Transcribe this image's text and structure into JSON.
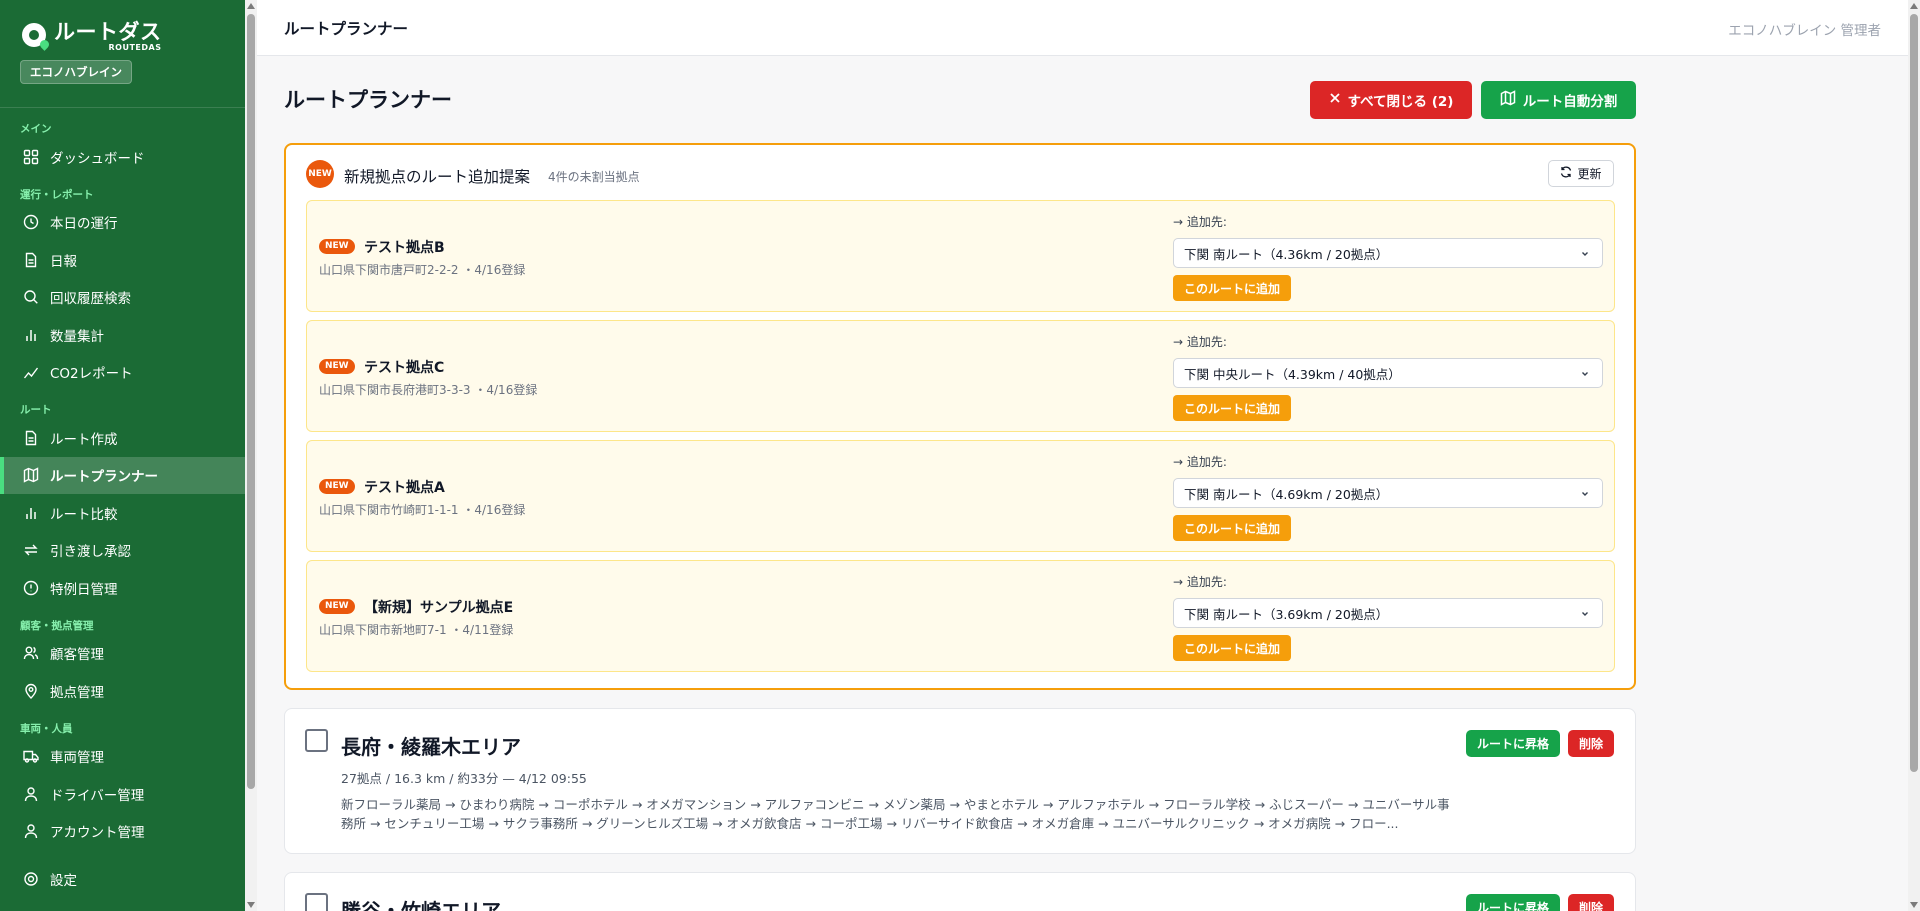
{
  "brand": {
    "name": "ルートダス",
    "sub": "ROUTEDAS",
    "company": "エコノハブレイン"
  },
  "colors": {
    "sidebar": "#1b6b35",
    "primary": "#16a34a",
    "danger": "#dc2626",
    "warning": "#f59e0b",
    "new": "#ea580c"
  },
  "sidebar": {
    "sections": [
      {
        "label": "メイン",
        "items": [
          {
            "label": "ダッシュボード",
            "icon": "grid-icon"
          }
        ]
      },
      {
        "label": "運行・レポート",
        "items": [
          {
            "label": "本日の運行",
            "icon": "clock-icon"
          },
          {
            "label": "日報",
            "icon": "document-icon"
          },
          {
            "label": "回収履歴検索",
            "icon": "search-icon"
          },
          {
            "label": "数量集計",
            "icon": "bar-chart-icon"
          },
          {
            "label": "CO2レポート",
            "icon": "trend-icon"
          }
        ]
      },
      {
        "label": "ルート",
        "items": [
          {
            "label": "ルート作成",
            "icon": "document-icon"
          },
          {
            "label": "ルートプランナー",
            "icon": "map-icon",
            "active": true
          },
          {
            "label": "ルート比較",
            "icon": "bar-chart-icon"
          },
          {
            "label": "引き渡し承認",
            "icon": "repeat-icon"
          },
          {
            "label": "特例日管理",
            "icon": "alert-circle-icon"
          }
        ]
      },
      {
        "label": "顧客・拠点管理",
        "items": [
          {
            "label": "顧客管理",
            "icon": "users-icon"
          },
          {
            "label": "拠点管理",
            "icon": "pin-icon"
          }
        ]
      },
      {
        "label": "車両・人員",
        "items": [
          {
            "label": "車両管理",
            "icon": "truck-icon"
          },
          {
            "label": "ドライバー管理",
            "icon": "user-icon"
          },
          {
            "label": "アカウント管理",
            "icon": "user-icon"
          }
        ]
      },
      {
        "label": "",
        "items": [
          {
            "label": "設定",
            "icon": "gear-icon"
          }
        ]
      }
    ]
  },
  "topbar": {
    "title": "ルートプランナー",
    "user": "エコノハブレイン 管理者"
  },
  "page": {
    "title": "ルートプランナー",
    "close_all_label": "すべて閉じる (2)",
    "auto_split_label": "ルート自動分割"
  },
  "suggestions": {
    "badge": "NEW",
    "title": "新規拠点のルート追加提案",
    "count": "4件の未割当拠点",
    "refresh_label": "更新",
    "dest_label": "→ 追加先:",
    "add_label": "このルートに追加",
    "new_label": "NEW",
    "items": [
      {
        "name": "テスト拠点B",
        "address": "山口県下関市唐戸町2-2-2 ・4/16登録",
        "route": "下関 南ルート（4.36km / 20拠点）"
      },
      {
        "name": "テスト拠点C",
        "address": "山口県下関市長府港町3-3-3 ・4/16登録",
        "route": "下関 中央ルート（4.39km / 40拠点）"
      },
      {
        "name": "テスト拠点A",
        "address": "山口県下関市竹崎町1-1-1 ・4/16登録",
        "route": "下関 南ルート（4.69km / 20拠点）"
      },
      {
        "name": "【新規】サンプル拠点E",
        "address": "山口県下関市新地町7-1 ・4/11登録",
        "route": "下関 南ルート（3.69km / 20拠点）"
      }
    ]
  },
  "areas": {
    "promote_label": "ルートに昇格",
    "delete_label": "削除",
    "items": [
      {
        "title": "長府・綾羅木エリア",
        "meta": "27拠点 / 16.3 km / 約33分 — 4/12 09:55",
        "sequence": "新フローラル薬局 → ひまわり病院 → コーポホテル → オメガマンション → アルファコンビニ → メゾン薬局 → やまとホテル → アルファホテル → フローラル学校 → ふじスーパー → ユニバーサル事務所 → センチュリー工場 → サクラ事務所 → グリーンヒルズ工場 → オメガ飲食店 → コーポ工場 → リバーサイド飲食店 → オメガ倉庫 → ユニバーサルクリニック → オメガ病院 → フロー..."
      },
      {
        "title": "勝谷・竹崎エリア"
      }
    ]
  }
}
